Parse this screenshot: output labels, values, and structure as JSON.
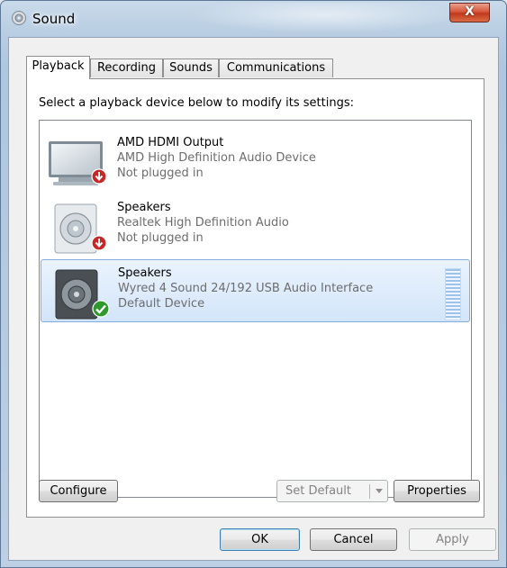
{
  "window": {
    "title": "Sound",
    "close_label": "X"
  },
  "tabs": [
    {
      "label": "Playback",
      "active": true
    },
    {
      "label": "Recording",
      "active": false
    },
    {
      "label": "Sounds",
      "active": false
    },
    {
      "label": "Communications",
      "active": false
    }
  ],
  "playback": {
    "instruction": "Select a playback device below to modify its settings:",
    "devices": [
      {
        "name": "AMD HDMI Output",
        "description": "AMD High Definition Audio Device",
        "status": "Not plugged in",
        "icon": "monitor-icon",
        "badge": "not-plugged-in-icon",
        "selected": false
      },
      {
        "name": "Speakers",
        "description": "Realtek High Definition Audio",
        "status": "Not plugged in",
        "icon": "speaker-icon",
        "badge": "not-plugged-in-icon",
        "selected": false
      },
      {
        "name": "Speakers",
        "description": "Wyred 4 Sound 24/192 USB Audio Interface",
        "status": "Default Device",
        "icon": "speaker-icon",
        "badge": "default-device-check-icon",
        "selected": true
      }
    ]
  },
  "buttons": {
    "configure": "Configure",
    "set_default": "Set Default",
    "properties": "Properties",
    "ok": "OK",
    "cancel": "Cancel",
    "apply": "Apply"
  },
  "colors": {
    "selection_fill": "#d3e5fa",
    "selection_border": "#84acdd",
    "badge_red": "#c62828",
    "badge_green": "#2e9a2e"
  }
}
